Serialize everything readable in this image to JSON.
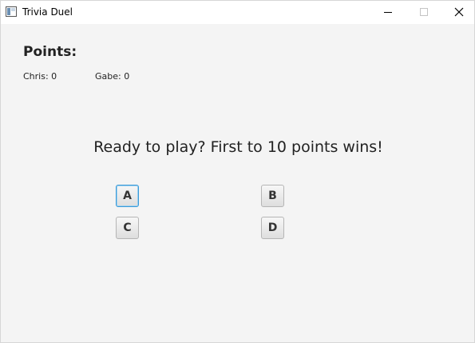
{
  "window": {
    "title": "Trivia Duel"
  },
  "scoreboard": {
    "heading": "Points:",
    "players": [
      {
        "label": "Chris: 0"
      },
      {
        "label": "Gabe: 0"
      }
    ]
  },
  "game": {
    "message": "Ready to play? First to 10 points wins!",
    "answers": [
      "A",
      "B",
      "C",
      "D"
    ]
  }
}
